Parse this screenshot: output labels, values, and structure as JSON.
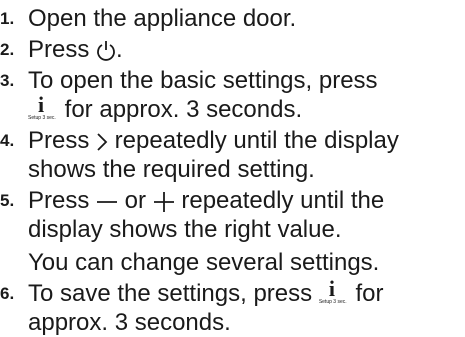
{
  "steps": [
    {
      "num": "1.",
      "text": "Open the appliance door."
    },
    {
      "num": "2.",
      "text_before": "Press ",
      "text_after": "."
    },
    {
      "num": "3.",
      "text_before": "To open the basic settings, press",
      "text_after": " for approx. 3 seconds."
    },
    {
      "num": "4.",
      "text_before": "Press ",
      "text_after": " repeatedly until the display shows the required setting."
    },
    {
      "num": "5.",
      "text_before": "Press ",
      "text_mid": " or ",
      "text_after": " repeatedly until the display shows the right value."
    },
    {
      "num": "6.",
      "text_before": "To save the settings, press ",
      "text_after": " for approx. 3 seconds."
    }
  ],
  "note": "You can change several settings.",
  "setup_icon_caption": "Setup 3 sec.",
  "icons": {
    "power": "power-icon",
    "setup": "setup-info-icon",
    "next": "chevron-right-icon",
    "minus": "minus-icon",
    "plus": "plus-icon"
  }
}
